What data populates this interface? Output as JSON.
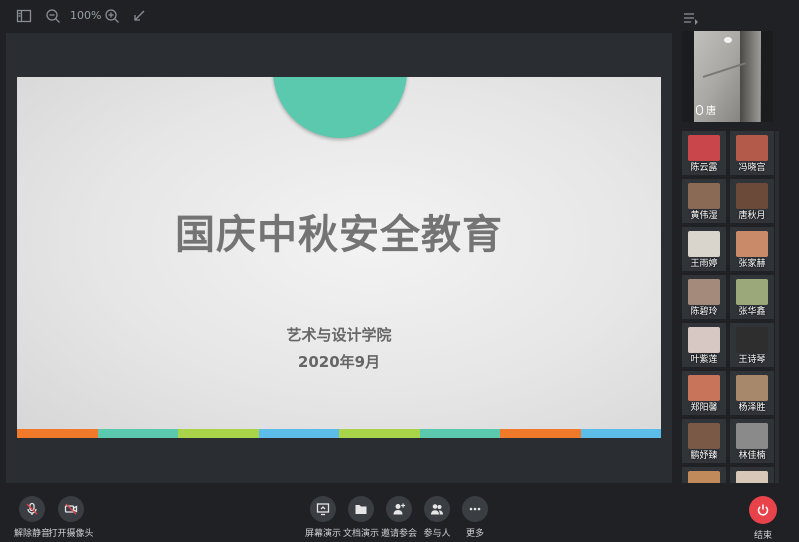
{
  "toolbar": {
    "zoom": "100%"
  },
  "slide": {
    "title": "国庆中秋安全教育",
    "subtitle": "艺术与设计学院",
    "date": "2020年9月",
    "circle_color": "#5bc9ad",
    "bar_colors": [
      "#f07a2a",
      "#5bc9ad",
      "#a9d44a",
      "#5bbde8",
      "#a9d44a",
      "#5bc9ad",
      "#f07a2a",
      "#5bbde8"
    ]
  },
  "self_video": {
    "name": "唐"
  },
  "participants": [
    {
      "name": "陈云露",
      "avatar_color": "#c9464a"
    },
    {
      "name": "冯晓宫",
      "avatar_color": "#b35a4a"
    },
    {
      "name": "黄伟湿",
      "avatar_color": "#8a6a55"
    },
    {
      "name": "唐秋月",
      "avatar_color": "#6b4a3a"
    },
    {
      "name": "王雨婷",
      "avatar_color": "#d9d4cc"
    },
    {
      "name": "张家赫",
      "avatar_color": "#c98a6a"
    },
    {
      "name": "陈碧玲",
      "avatar_color": "#a38a7a"
    },
    {
      "name": "张华鑫",
      "avatar_color": "#9aa87a"
    },
    {
      "name": "叶紫莲",
      "avatar_color": "#d8c8c4"
    },
    {
      "name": "王诗琴",
      "avatar_color": "#2e2e2e"
    },
    {
      "name": "郑阳馨",
      "avatar_color": "#c8745a"
    },
    {
      "name": "杨泽胜",
      "avatar_color": "#a8886a"
    },
    {
      "name": "鹏妤臻",
      "avatar_color": "#7a5a46"
    },
    {
      "name": "林佳楠",
      "avatar_color": "#8a8a8a"
    },
    {
      "name": "",
      "avatar_color": "#c08a5a"
    },
    {
      "name": "",
      "avatar_color": "#d8c8b8"
    }
  ],
  "bottom": {
    "unmute": "解除静音",
    "camera": "打开摄像头",
    "screen_share": "屏幕演示",
    "doc_share": "文档演示",
    "invite": "邀请参会",
    "participants": "参与人",
    "more": "更多",
    "end": "结束",
    "end_color": "#e8434b"
  }
}
